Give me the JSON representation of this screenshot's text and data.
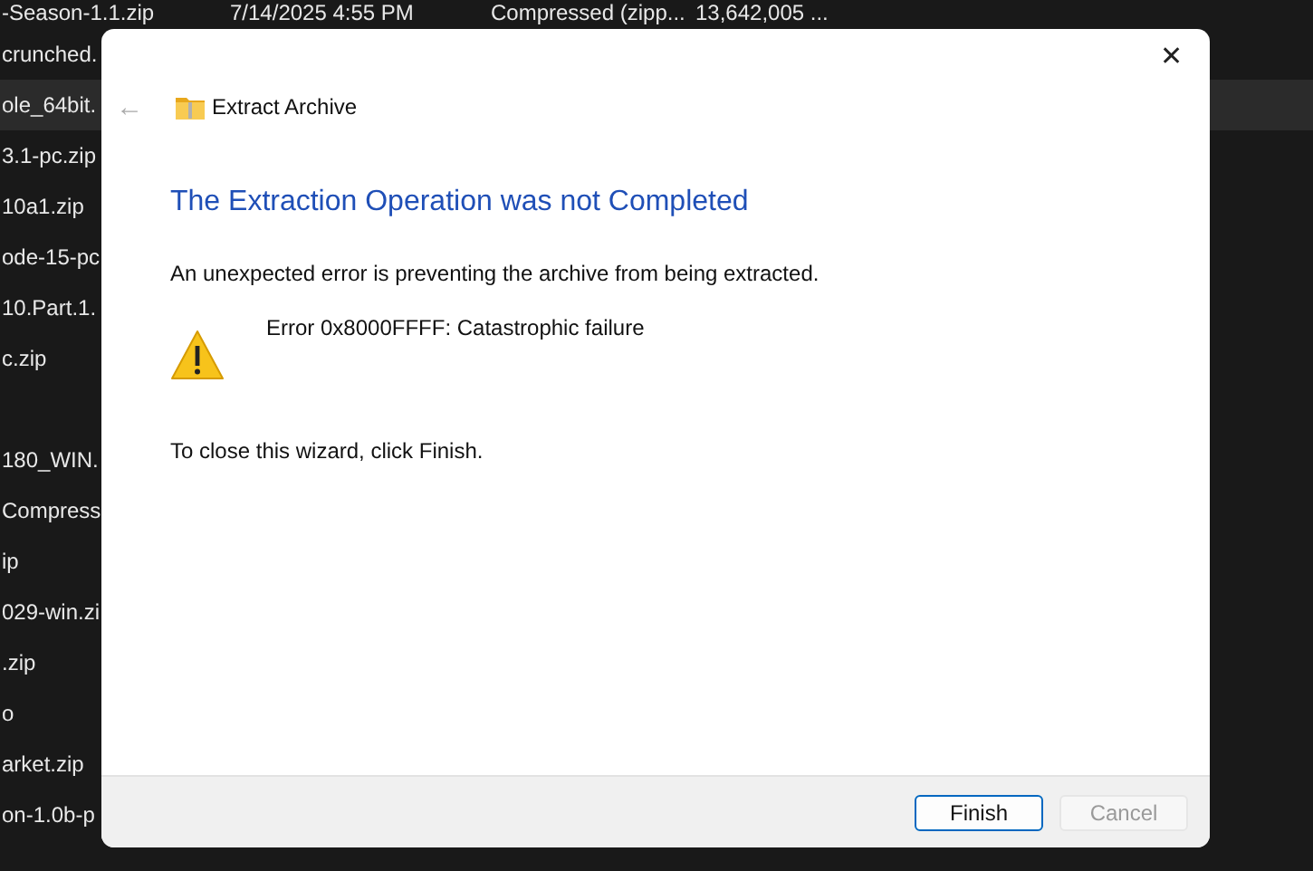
{
  "file_list": [
    {
      "kind": "file",
      "name": "-Season-1.1.zip",
      "date": "7/14/2025 4:55 PM",
      "type": "Compressed (zipp...",
      "size": "13,642,005 ...",
      "selected": false
    },
    {
      "kind": "file",
      "name": "crunched.",
      "selected": false
    },
    {
      "kind": "file",
      "name": "ole_64bit.",
      "selected": true
    },
    {
      "kind": "file",
      "name": "3.1-pc.zip",
      "selected": false
    },
    {
      "kind": "file",
      "name": "10a1.zip",
      "selected": false
    },
    {
      "kind": "file",
      "name": "ode-15-pc",
      "selected": false
    },
    {
      "kind": "file",
      "name": "10.Part.1.",
      "selected": false
    },
    {
      "kind": "file",
      "name": "c.zip",
      "selected": false
    },
    {
      "kind": "blank"
    },
    {
      "kind": "file",
      "name": "180_WIN.",
      "selected": false
    },
    {
      "kind": "file",
      "name": "Compress",
      "selected": false
    },
    {
      "kind": "file",
      "name": "ip",
      "selected": false
    },
    {
      "kind": "file",
      "name": "029-win.zi",
      "selected": false
    },
    {
      "kind": "file",
      "name": ".zip",
      "selected": false
    },
    {
      "kind": "file",
      "name": "o",
      "selected": false
    },
    {
      "kind": "file",
      "name": "arket.zip",
      "selected": false
    },
    {
      "kind": "file",
      "name": "on-1.0b-p",
      "selected": false
    }
  ],
  "dialog": {
    "close": "✕",
    "back": "←",
    "title": "Extract Archive",
    "heading": "The Extraction Operation was not Completed",
    "message": "An unexpected error is preventing the archive from being extracted.",
    "error": "Error 0x8000FFFF: Catastrophic failure",
    "instruction": "To close this wizard, click Finish.",
    "buttons": [
      {
        "label": "Finish",
        "default": true,
        "disabled": false
      },
      {
        "label": "Cancel",
        "default": false,
        "disabled": true
      }
    ]
  }
}
